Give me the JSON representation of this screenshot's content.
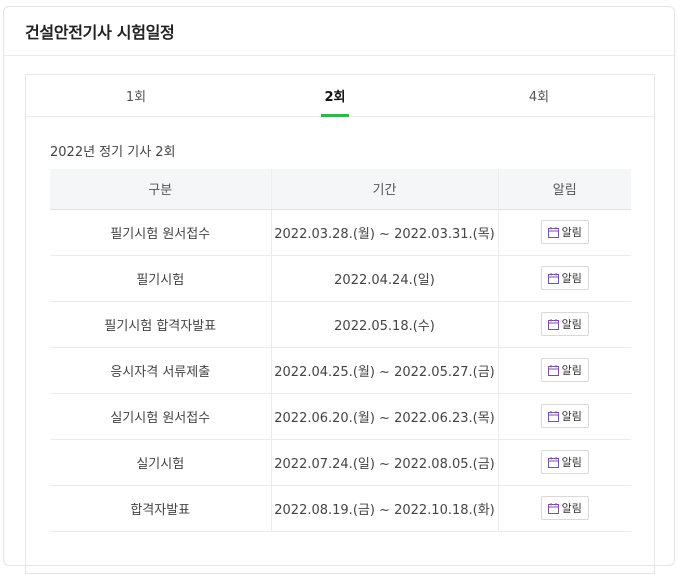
{
  "header": {
    "title": "건설안전기사 시험일정"
  },
  "tabs": [
    {
      "label": "1회"
    },
    {
      "label": "2회"
    },
    {
      "label": "4회"
    }
  ],
  "section": {
    "title": "2022년 정기 기사 2회"
  },
  "table": {
    "headers": {
      "category": "구분",
      "period": "기간",
      "alarm": "알림"
    },
    "rows": [
      {
        "category": "필기시험 원서접수",
        "period": "2022.03.28.(월) ~ 2022.03.31.(목)",
        "alarm": "알림"
      },
      {
        "category": "필기시험",
        "period": "2022.04.24.(일)",
        "alarm": "알림"
      },
      {
        "category": "필기시험 합격자발표",
        "period": "2022.05.18.(수)",
        "alarm": "알림"
      },
      {
        "category": "응시자격 서류제출",
        "period": "2022.04.25.(월) ~ 2022.05.27.(금)",
        "alarm": "알림"
      },
      {
        "category": "실기시험 원서접수",
        "period": "2022.06.20.(월) ~ 2022.06.23.(목)",
        "alarm": "알림"
      },
      {
        "category": "실기시험",
        "period": "2022.07.24.(일) ~ 2022.08.05.(금)",
        "alarm": "알림"
      },
      {
        "category": "합격자발표",
        "period": "2022.08.19.(금) ~ 2022.10.18.(화)",
        "alarm": "알림"
      }
    ]
  },
  "colors": {
    "accent": "#2eb84b",
    "icon": "#7b4fa6"
  },
  "icons": {
    "alarm": "calendar-icon"
  }
}
